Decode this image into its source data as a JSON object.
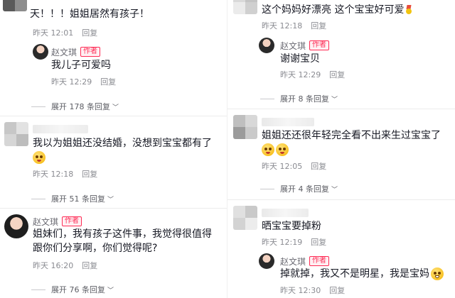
{
  "left": {
    "c1": {
      "text": "天！！！姐姐居然有孩子！",
      "time": "昨天 12:01",
      "reply": "回复"
    },
    "c1_reply": {
      "author": "赵文琪",
      "badge": "作者",
      "text": "我儿子可爱吗",
      "time": "昨天 12:29",
      "reply": "回复"
    },
    "c1_expand": "展开 178 条回复",
    "c2": {
      "text": "我以为姐姐还没结婚，没想到宝宝都有了",
      "time": "昨天 12:18",
      "reply": "回复"
    },
    "c2_expand": "展开 51 条回复",
    "c3": {
      "author": "赵文琪",
      "badge": "作者",
      "text": "姐妹们，我有孩子这件事，我觉得很值得跟你们分享啊，你们觉得呢?",
      "time": "昨天 16:20",
      "reply": "回复"
    },
    "c3_expand": "展开 76 条回复"
  },
  "right": {
    "c1": {
      "text": "这个妈妈好漂亮 这个宝宝好可爱",
      "time": "昨天 12:18",
      "reply": "回复"
    },
    "c1_reply": {
      "author": "赵文琪",
      "badge": "作者",
      "text": "谢谢宝贝",
      "time": "昨天 12:29",
      "reply": "回复"
    },
    "c1_expand": "展开 8 条回复",
    "c2": {
      "text": "姐姐还还很年轻完全看不出来生过宝宝了",
      "time": "昨天 12:05",
      "reply": "回复"
    },
    "c2_expand": "展开 4 条回复",
    "c3": {
      "text": "晒宝宝要掉粉",
      "time": "昨天 12:19",
      "reply": "回复"
    },
    "c3_reply": {
      "author": "赵文琪",
      "badge": "作者",
      "text": "掉就掉，我又不是明星，我是宝妈",
      "time": "昨天 12:30",
      "reply": "回复"
    }
  },
  "icons": {
    "chevron": "chevron-down-icon",
    "emoji": "pleading-face-emoji-icon",
    "medal": "medal-icon"
  },
  "colors": {
    "badge": "#fe2c55",
    "meta": "#8a8b91",
    "text": "#161823"
  }
}
